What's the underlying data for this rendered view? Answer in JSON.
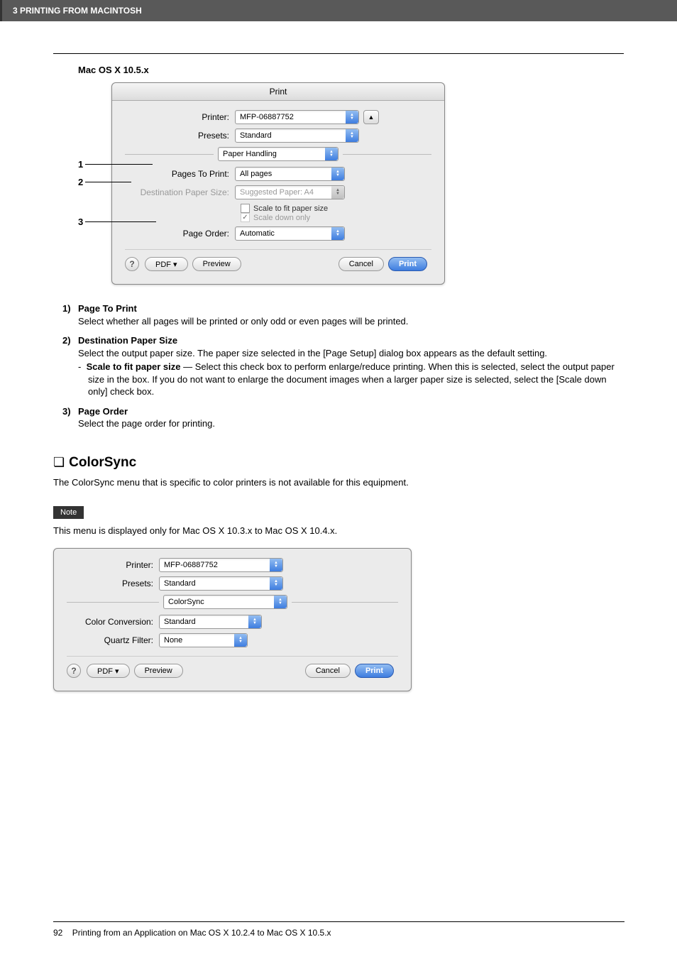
{
  "header": {
    "chapter": "3 PRINTING FROM MACINTOSH"
  },
  "subtitle": "Mac OS X 10.5.x",
  "dialog1": {
    "title": "Print",
    "printer_label": "Printer:",
    "printer_value": "MFP-06887752",
    "presets_label": "Presets:",
    "presets_value": "Standard",
    "pane_value": "Paper Handling",
    "pages_label": "Pages To Print:",
    "pages_value": "All pages",
    "dest_label": "Destination Paper Size:",
    "dest_value": "Suggested Paper: A4",
    "scale_fit": "Scale to fit paper size",
    "scale_down": "Scale down only",
    "order_label": "Page Order:",
    "order_value": "Automatic",
    "help": "?",
    "pdf": "PDF ▾",
    "preview": "Preview",
    "cancel": "Cancel",
    "print": "Print"
  },
  "callouts": {
    "n1": "1",
    "n2": "2",
    "n3": "3"
  },
  "list": {
    "i1": {
      "num": "1)",
      "title": "Page To Print",
      "desc": "Select whether all pages will be printed or only odd or even pages will be printed."
    },
    "i2": {
      "num": "2)",
      "title": "Destination Paper Size",
      "desc": "Select the output paper size. The paper size selected in the [Page Setup] dialog box appears as the default setting.",
      "sub_title": "Scale to fit paper size",
      "sub_desc": " — Select this check box to perform enlarge/reduce printing. When this is selected, select the output paper size in the box. If you do not want to enlarge the document images when a larger paper size is selected, select the [Scale down only] check box."
    },
    "i3": {
      "num": "3)",
      "title": "Page Order",
      "desc": "Select the page order for printing."
    }
  },
  "colorsync": {
    "title": "ColorSync",
    "intro": "The ColorSync menu that is specific to color printers is not available for this equipment.",
    "note_label": "Note",
    "note_text": "This menu is displayed only for Mac OS X 10.3.x to Mac OS X 10.4.x."
  },
  "dialog2": {
    "printer_label": "Printer:",
    "printer_value": "MFP-06887752",
    "presets_label": "Presets:",
    "presets_value": "Standard",
    "pane_value": "ColorSync",
    "conv_label": "Color Conversion:",
    "conv_value": "Standard",
    "filter_label": "Quartz Filter:",
    "filter_value": "None",
    "help": "?",
    "pdf": "PDF ▾",
    "preview": "Preview",
    "cancel": "Cancel",
    "print": "Print"
  },
  "footer": {
    "page": "92",
    "text": "Printing from an Application on Mac OS X 10.2.4 to Mac OS X 10.5.x"
  }
}
